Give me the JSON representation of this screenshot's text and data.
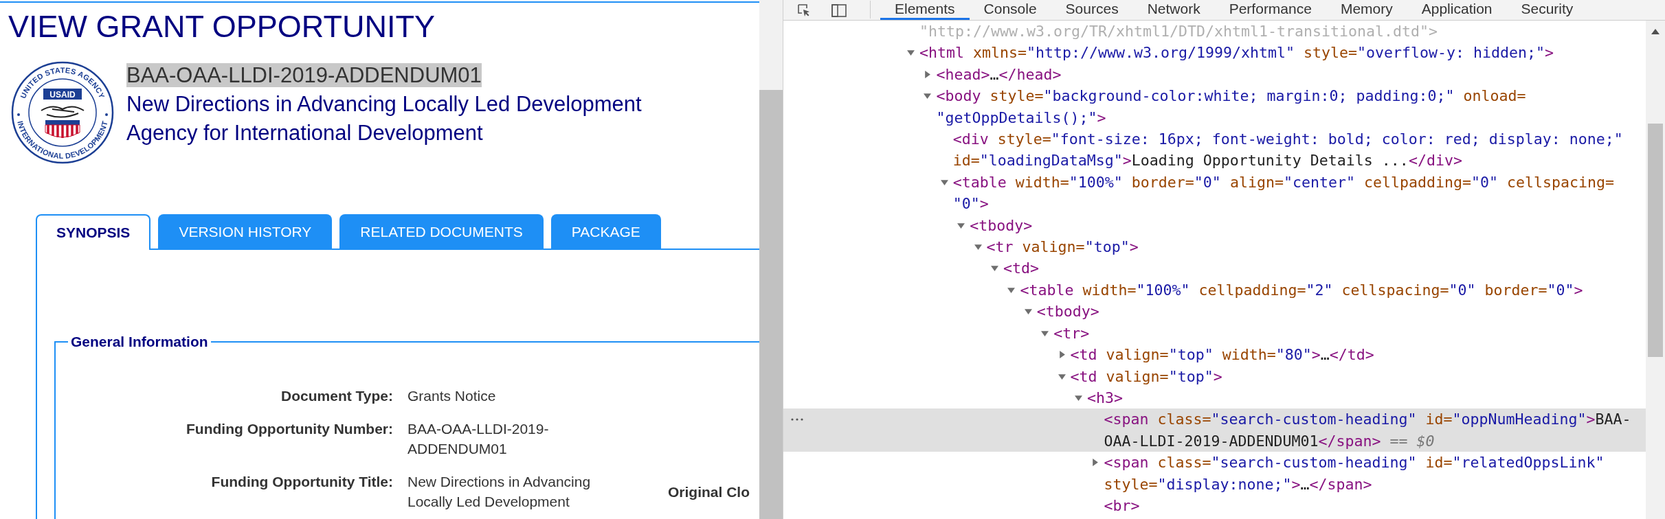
{
  "page": {
    "title": "VIEW GRANT OPPORTUNITY",
    "logo": {
      "top_text": "UNITED STATES AGENCY",
      "center_text": "USAID",
      "bottom_text": "INTERNATIONAL DEVELOPMENT"
    },
    "headings": [
      {
        "text": "BAA-OAA-LLDI-2019-ADDENDUM01",
        "highlighted": true
      },
      {
        "text": "New Directions in Advancing Locally Led Development",
        "highlighted": false
      },
      {
        "text": "Agency for International Development",
        "highlighted": false
      }
    ],
    "tabs": [
      {
        "label": "SYNOPSIS",
        "selected": true
      },
      {
        "label": "VERSION HISTORY",
        "selected": false
      },
      {
        "label": "RELATED DOCUMENTS",
        "selected": false
      },
      {
        "label": "PACKAGE",
        "selected": false
      }
    ],
    "general_information": {
      "legend": "General Information",
      "rows": [
        {
          "label": "Document Type:",
          "value": "Grants Notice"
        },
        {
          "label": "Funding Opportunity Number:",
          "value": "BAA-OAA-LLDI-2019-ADDENDUM01"
        },
        {
          "label": "Funding Opportunity Title:",
          "value": "New Directions in Advancing Locally Led Development",
          "side_label": "Original Clo"
        }
      ]
    }
  },
  "devtools": {
    "tabs": [
      {
        "label": "Elements",
        "selected": true
      },
      {
        "label": "Console",
        "selected": false
      },
      {
        "label": "Sources",
        "selected": false
      },
      {
        "label": "Network",
        "selected": false
      },
      {
        "label": "Performance",
        "selected": false
      },
      {
        "label": "Memory",
        "selected": false
      },
      {
        "label": "Application",
        "selected": false
      },
      {
        "label": "Security",
        "selected": false
      }
    ],
    "dom_tree": [
      {
        "kind": "leaf",
        "selected": false,
        "parts": [
          {
            "kind": "doctype",
            "text": "\"http://www.w3.org/TR/xhtml1/DTD/xhtml1-transitional.dtd\">"
          }
        ]
      },
      {
        "kind": "expandable",
        "expanded": true,
        "selected": false,
        "parts": [
          {
            "kind": "tag",
            "text": "<html"
          },
          {
            "kind": "attr",
            "text": " xmlns="
          },
          {
            "kind": "value",
            "text": "\"http://www.w3.org/1999/xhtml\""
          },
          {
            "kind": "attr",
            "text": " style="
          },
          {
            "kind": "value",
            "text": "\"overflow-y: hidden;\""
          },
          {
            "kind": "tag",
            "text": ">"
          }
        ],
        "children": [
          {
            "kind": "expandable",
            "expanded": false,
            "selected": false,
            "parts": [
              {
                "kind": "tag",
                "text": "<head>"
              },
              {
                "kind": "text",
                "text": "…"
              },
              {
                "kind": "tag",
                "text": "</head>"
              }
            ]
          },
          {
            "kind": "expandable",
            "expanded": true,
            "selected": false,
            "parts": [
              {
                "kind": "tag",
                "text": "<body"
              },
              {
                "kind": "attr",
                "text": " style="
              },
              {
                "kind": "value",
                "text": "\"background-color:white; margin:0; padding:0;\""
              },
              {
                "kind": "attr",
                "text": " onload="
              },
              {
                "kind": "value",
                "text": "\"getOppDetails();\""
              },
              {
                "kind": "tag",
                "text": ">"
              }
            ],
            "children": [
              {
                "kind": "leaf",
                "selected": false,
                "parts": [
                  {
                    "kind": "tag",
                    "text": "<div"
                  },
                  {
                    "kind": "attr",
                    "text": " style="
                  },
                  {
                    "kind": "value",
                    "text": "\"font-size: 16px; font-weight: bold; color: red; display: none;\""
                  },
                  {
                    "kind": "attr",
                    "text": " id="
                  },
                  {
                    "kind": "value",
                    "text": "\"loadingDataMsg\""
                  },
                  {
                    "kind": "tag",
                    "text": ">"
                  },
                  {
                    "kind": "text",
                    "text": "Loading Opportunity Details ..."
                  },
                  {
                    "kind": "tag",
                    "text": "</div>"
                  }
                ]
              },
              {
                "kind": "expandable",
                "expanded": true,
                "selected": false,
                "parts": [
                  {
                    "kind": "tag",
                    "text": "<table"
                  },
                  {
                    "kind": "attr",
                    "text": " width="
                  },
                  {
                    "kind": "value",
                    "text": "\"100%\""
                  },
                  {
                    "kind": "attr",
                    "text": " border="
                  },
                  {
                    "kind": "value",
                    "text": "\"0\""
                  },
                  {
                    "kind": "attr",
                    "text": " align="
                  },
                  {
                    "kind": "value",
                    "text": "\"center\""
                  },
                  {
                    "kind": "attr",
                    "text": " cellpadding="
                  },
                  {
                    "kind": "value",
                    "text": "\"0\""
                  },
                  {
                    "kind": "attr",
                    "text": " cellspacing="
                  },
                  {
                    "kind": "value",
                    "text": "\"0\""
                  },
                  {
                    "kind": "tag",
                    "text": ">"
                  }
                ],
                "children": [
                  {
                    "kind": "expandable",
                    "expanded": true,
                    "selected": false,
                    "parts": [
                      {
                        "kind": "tag",
                        "text": "<tbody>"
                      }
                    ],
                    "children": [
                      {
                        "kind": "expandable",
                        "expanded": true,
                        "selected": false,
                        "parts": [
                          {
                            "kind": "tag",
                            "text": "<tr"
                          },
                          {
                            "kind": "attr",
                            "text": " valign="
                          },
                          {
                            "kind": "value",
                            "text": "\"top\""
                          },
                          {
                            "kind": "tag",
                            "text": ">"
                          }
                        ],
                        "children": [
                          {
                            "kind": "expandable",
                            "expanded": true,
                            "selected": false,
                            "parts": [
                              {
                                "kind": "tag",
                                "text": "<td>"
                              }
                            ],
                            "children": [
                              {
                                "kind": "expandable",
                                "expanded": true,
                                "selected": false,
                                "parts": [
                                  {
                                    "kind": "tag",
                                    "text": "<table"
                                  },
                                  {
                                    "kind": "attr",
                                    "text": " width="
                                  },
                                  {
                                    "kind": "value",
                                    "text": "\"100%\""
                                  },
                                  {
                                    "kind": "attr",
                                    "text": " cellpadding="
                                  },
                                  {
                                    "kind": "value",
                                    "text": "\"2\""
                                  },
                                  {
                                    "kind": "attr",
                                    "text": " cellspacing="
                                  },
                                  {
                                    "kind": "value",
                                    "text": "\"0\""
                                  },
                                  {
                                    "kind": "attr",
                                    "text": " border="
                                  },
                                  {
                                    "kind": "value",
                                    "text": "\"0\""
                                  },
                                  {
                                    "kind": "tag",
                                    "text": ">"
                                  }
                                ],
                                "children": [
                                  {
                                    "kind": "expandable",
                                    "expanded": true,
                                    "selected": false,
                                    "parts": [
                                      {
                                        "kind": "tag",
                                        "text": "<tbody>"
                                      }
                                    ],
                                    "children": [
                                      {
                                        "kind": "expandable",
                                        "expanded": true,
                                        "selected": false,
                                        "parts": [
                                          {
                                            "kind": "tag",
                                            "text": "<tr>"
                                          }
                                        ],
                                        "children": [
                                          {
                                            "kind": "expandable",
                                            "expanded": false,
                                            "selected": false,
                                            "parts": [
                                              {
                                                "kind": "tag",
                                                "text": "<td"
                                              },
                                              {
                                                "kind": "attr",
                                                "text": " valign="
                                              },
                                              {
                                                "kind": "value",
                                                "text": "\"top\""
                                              },
                                              {
                                                "kind": "attr",
                                                "text": " width="
                                              },
                                              {
                                                "kind": "value",
                                                "text": "\"80\""
                                              },
                                              {
                                                "kind": "tag",
                                                "text": ">"
                                              },
                                              {
                                                "kind": "text",
                                                "text": "…"
                                              },
                                              {
                                                "kind": "tag",
                                                "text": "</td>"
                                              }
                                            ]
                                          },
                                          {
                                            "kind": "expandable",
                                            "expanded": true,
                                            "selected": false,
                                            "parts": [
                                              {
                                                "kind": "tag",
                                                "text": "<td"
                                              },
                                              {
                                                "kind": "attr",
                                                "text": " valign="
                                              },
                                              {
                                                "kind": "value",
                                                "text": "\"top\""
                                              },
                                              {
                                                "kind": "tag",
                                                "text": ">"
                                              }
                                            ],
                                            "children": [
                                              {
                                                "kind": "expandable",
                                                "expanded": true,
                                                "selected": false,
                                                "parts": [
                                                  {
                                                    "kind": "tag",
                                                    "text": "<h3>"
                                                  }
                                                ],
                                                "children": [
                                                  {
                                                    "kind": "leaf",
                                                    "selected": true,
                                                    "parts": [
                                                      {
                                                        "kind": "tag",
                                                        "text": "<span"
                                                      },
                                                      {
                                                        "kind": "attr",
                                                        "text": " class="
                                                      },
                                                      {
                                                        "kind": "value",
                                                        "text": "\"search-custom-heading\""
                                                      },
                                                      {
                                                        "kind": "attr",
                                                        "text": " id="
                                                      },
                                                      {
                                                        "kind": "value",
                                                        "text": "\"oppNumHeading\""
                                                      },
                                                      {
                                                        "kind": "tag",
                                                        "text": ">"
                                                      },
                                                      {
                                                        "kind": "text",
                                                        "text": "BAA-OAA-LLDI-2019-ADDENDUM01"
                                                      },
                                                      {
                                                        "kind": "tag",
                                                        "text": "</span>"
                                                      },
                                                      {
                                                        "kind": "ref",
                                                        "text": " == $0"
                                                      }
                                                    ]
                                                  },
                                                  {
                                                    "kind": "expandable",
                                                    "expanded": false,
                                                    "selected": false,
                                                    "parts": [
                                                      {
                                                        "kind": "tag",
                                                        "text": "<span"
                                                      },
                                                      {
                                                        "kind": "attr",
                                                        "text": " class="
                                                      },
                                                      {
                                                        "kind": "value",
                                                        "text": "\"search-custom-heading\""
                                                      },
                                                      {
                                                        "kind": "attr",
                                                        "text": " id="
                                                      },
                                                      {
                                                        "kind": "value",
                                                        "text": "\"relatedOppsLink\""
                                                      },
                                                      {
                                                        "kind": "attr",
                                                        "text": " style="
                                                      },
                                                      {
                                                        "kind": "value",
                                                        "text": "\"display:none;\""
                                                      },
                                                      {
                                                        "kind": "tag",
                                                        "text": ">"
                                                      },
                                                      {
                                                        "kind": "text",
                                                        "text": "…"
                                                      },
                                                      {
                                                        "kind": "tag",
                                                        "text": "</span>"
                                                      }
                                                    ]
                                                  },
                                                  {
                                                    "kind": "leaf",
                                                    "selected": false,
                                                    "parts": [
                                                      {
                                                        "kind": "tag",
                                                        "text": "<br>"
                                                      }
                                                    ]
                                                  }
                                                ]
                                              }
                                            ]
                                          }
                                        ]
                                      }
                                    ]
                                  }
                                ]
                              }
                            ]
                          }
                        ]
                      }
                    ]
                  }
                ]
              }
            ]
          }
        ]
      }
    ]
  }
}
